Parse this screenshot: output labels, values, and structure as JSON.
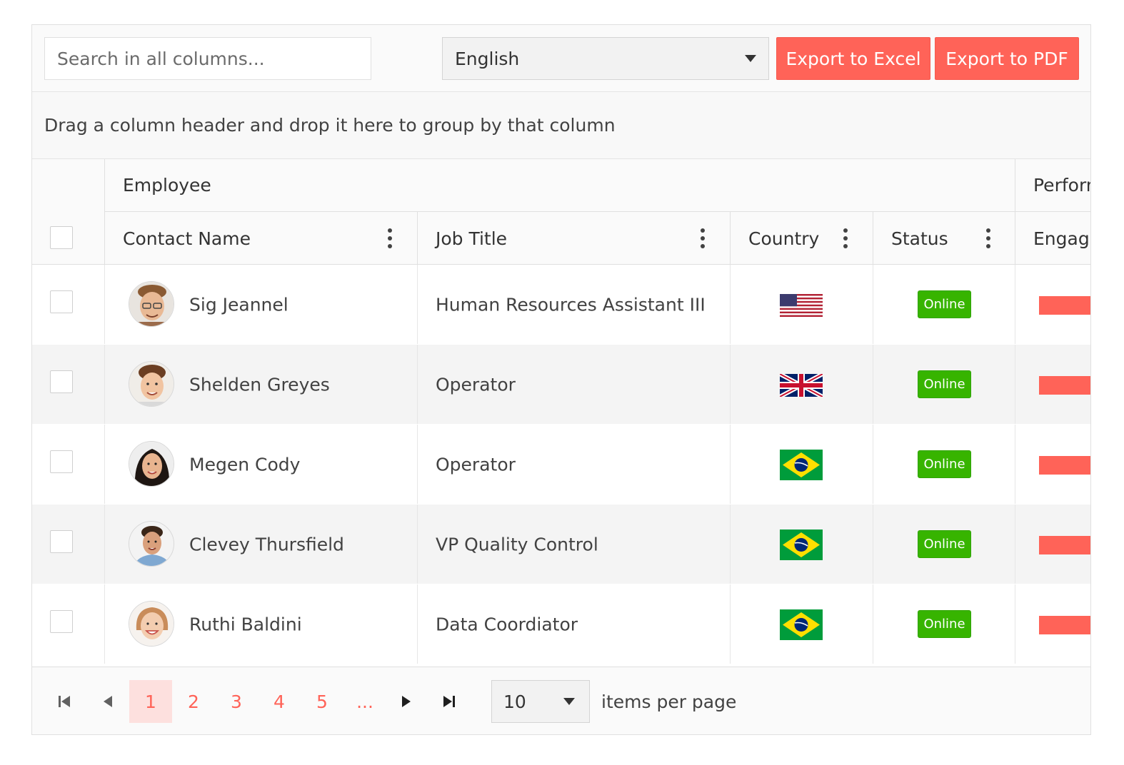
{
  "toolbar": {
    "search_placeholder": "Search in all columns...",
    "language": "English",
    "export_excel": "Export to Excel",
    "export_pdf": "Export to PDF"
  },
  "group_panel": {
    "hint": "Drag a column header and drop it here to group by that column"
  },
  "header": {
    "groups": {
      "employee": "Employee",
      "performance": "Perform"
    },
    "columns": {
      "contact_name": "Contact Name",
      "job_title": "Job Title",
      "country": "Country",
      "status": "Status",
      "engagement": "Engage"
    }
  },
  "rows": [
    {
      "contact_name": "Sig Jeannel",
      "job_title": "Human Resources Assistant III",
      "country_flag": "us-flag-icon",
      "status": "Online"
    },
    {
      "contact_name": "Shelden Greyes",
      "job_title": "Operator",
      "country_flag": "uk-flag-icon",
      "status": "Online"
    },
    {
      "contact_name": "Megen Cody",
      "job_title": "Operator",
      "country_flag": "brazil-flag-icon",
      "status": "Online"
    },
    {
      "contact_name": "Clevey Thursfield",
      "job_title": "VP Quality Control",
      "country_flag": "brazil-flag-icon",
      "status": "Online"
    },
    {
      "contact_name": "Ruthi Baldini",
      "job_title": "Data Coordiator",
      "country_flag": "brazil-flag-icon",
      "status": "Online"
    }
  ],
  "pager": {
    "pages": [
      "1",
      "2",
      "3",
      "4",
      "5",
      "..."
    ],
    "current_page": "1",
    "page_size": "10",
    "items_per_page_label": "items per page"
  },
  "colors": {
    "accent": "#ff6358",
    "online": "#37b400",
    "active_page_bg": "#fde0de"
  }
}
